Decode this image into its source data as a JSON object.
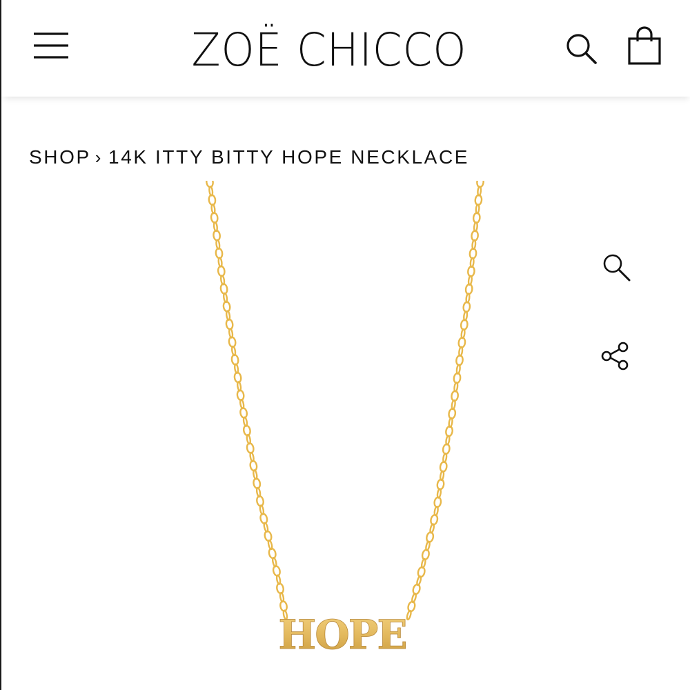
{
  "header": {
    "brand": "ZOË CHICCO",
    "menu_icon": "hamburger-menu-icon",
    "search_icon": "search-icon",
    "cart_icon": "shopping-bag-icon"
  },
  "breadcrumb": {
    "items": [
      {
        "label": "SHOP"
      },
      {
        "label": "14K ITTY BITTY HOPE NECKLACE"
      }
    ],
    "separator": "›"
  },
  "product": {
    "pendant_text": "HOPE",
    "metal_color": "#E8B84A",
    "pendant_color": "#E3B95E"
  },
  "side_actions": {
    "zoom_icon": "zoom-icon",
    "share_icon": "share-icon"
  }
}
